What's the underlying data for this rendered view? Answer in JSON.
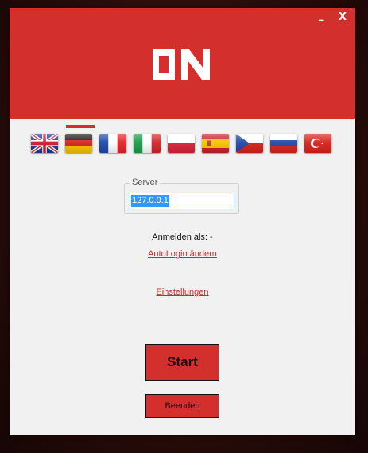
{
  "window": {
    "minimize_label": "_",
    "close_label": "X"
  },
  "logo": {
    "text": "ON"
  },
  "languages": {
    "items": [
      "English",
      "Deutsch",
      "Français",
      "Italiano",
      "Polski",
      "Español",
      "Čeština",
      "Русский",
      "Türkçe"
    ],
    "selected": "Deutsch"
  },
  "server": {
    "label": "Server",
    "value": "127.0.0.1"
  },
  "login_status": "Anmelden als: -",
  "autologin_link": "AutoLogin ändern",
  "settings_link": "Einstellungen",
  "start_button": "Start",
  "quit_button": "Beenden",
  "colors": {
    "accent": "#d22f2d",
    "background": "#f1f1f1",
    "selection": "#3399ff"
  }
}
